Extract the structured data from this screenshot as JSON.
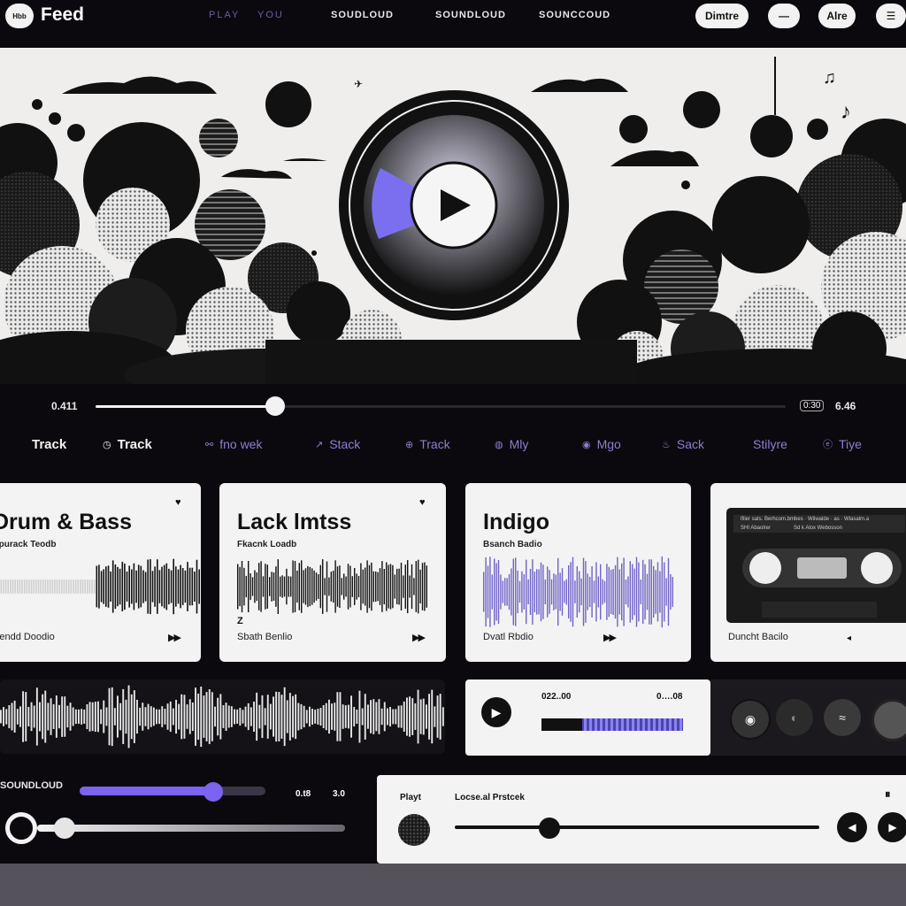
{
  "topbar": {
    "logo_text": "Hbb",
    "brand": "Feed",
    "nav": [
      "PLAY",
      "YOU",
      "SOUDLOUD",
      "SOUNDLOUD",
      "SOUNCCOUD"
    ],
    "pills": [
      "Dimtre",
      "—",
      "Alre",
      "☰"
    ]
  },
  "player": {
    "elapsed": "0.411",
    "total": "6.46",
    "chip": "0:30",
    "progress_fraction": 0.26
  },
  "tabs": [
    {
      "label": "Track",
      "icon": "none-icon",
      "glyph": "",
      "style": "bold"
    },
    {
      "label": "Track",
      "icon": "clock-icon",
      "glyph": "◷",
      "style": "bold"
    },
    {
      "label": "fno wek",
      "icon": "link-icon",
      "glyph": "⚯",
      "style": "dim"
    },
    {
      "label": "Stack",
      "icon": "arrow-icon",
      "glyph": "↗",
      "style": "dim"
    },
    {
      "label": "Track",
      "icon": "circle-plus-icon",
      "glyph": "⊕",
      "style": "dim"
    },
    {
      "label": "Mly",
      "icon": "globe-icon",
      "glyph": "◍",
      "style": "dim"
    },
    {
      "label": "Mgo",
      "icon": "user-icon",
      "glyph": "◉",
      "style": "dim"
    },
    {
      "label": "Sack",
      "icon": "flame-icon",
      "glyph": "♨",
      "style": "dim"
    },
    {
      "label": "Stilyre",
      "icon": "none-icon",
      "glyph": "",
      "style": "dim"
    },
    {
      "label": "Tiye",
      "icon": "e-icon",
      "glyph": "ⓔ",
      "style": "dim"
    }
  ],
  "cards": [
    {
      "title": "Drum & Bass",
      "subtitle": "Spurack Teodb",
      "footer": "Sendd Doodio",
      "waveform_color": "#111111"
    },
    {
      "title": "Lack lmtss",
      "subtitle": "Fkacnk Loadb",
      "footer": "Sbath Benlio",
      "footer_tag": "Z",
      "waveform_color": "#111111"
    },
    {
      "title": "Indigo",
      "subtitle": "Bsanch Badio",
      "footer": "Dvatl Rbdio",
      "waveform_color": "#6f63c7"
    },
    {
      "title": "",
      "subtitle": "",
      "footer": "Duncht Bacilo",
      "cassette_line1": "lfiler sats. Berhcom.bmbes · Wilwalde · as · Wlasalm.a",
      "cassette_line2": "SHI Abaolrer",
      "cassette_line3": "Sd k Alox Webosson"
    }
  ],
  "mini_player": {
    "time_left": "022..00",
    "time_right": "0….08",
    "progress_fraction": 0.29
  },
  "bottom": {
    "label": "SOUNDLOUD",
    "time_a": "0.t8",
    "time_b": "3.0",
    "volume_fraction": 0.72,
    "seek_fraction": 0.09,
    "player_label": "Playt",
    "player_track": "Locse.al Prstcek",
    "player_progress_fraction": 0.26
  },
  "colors": {
    "accent": "#7c63f0",
    "background": "#0b090d",
    "card": "#f3f3f3"
  }
}
